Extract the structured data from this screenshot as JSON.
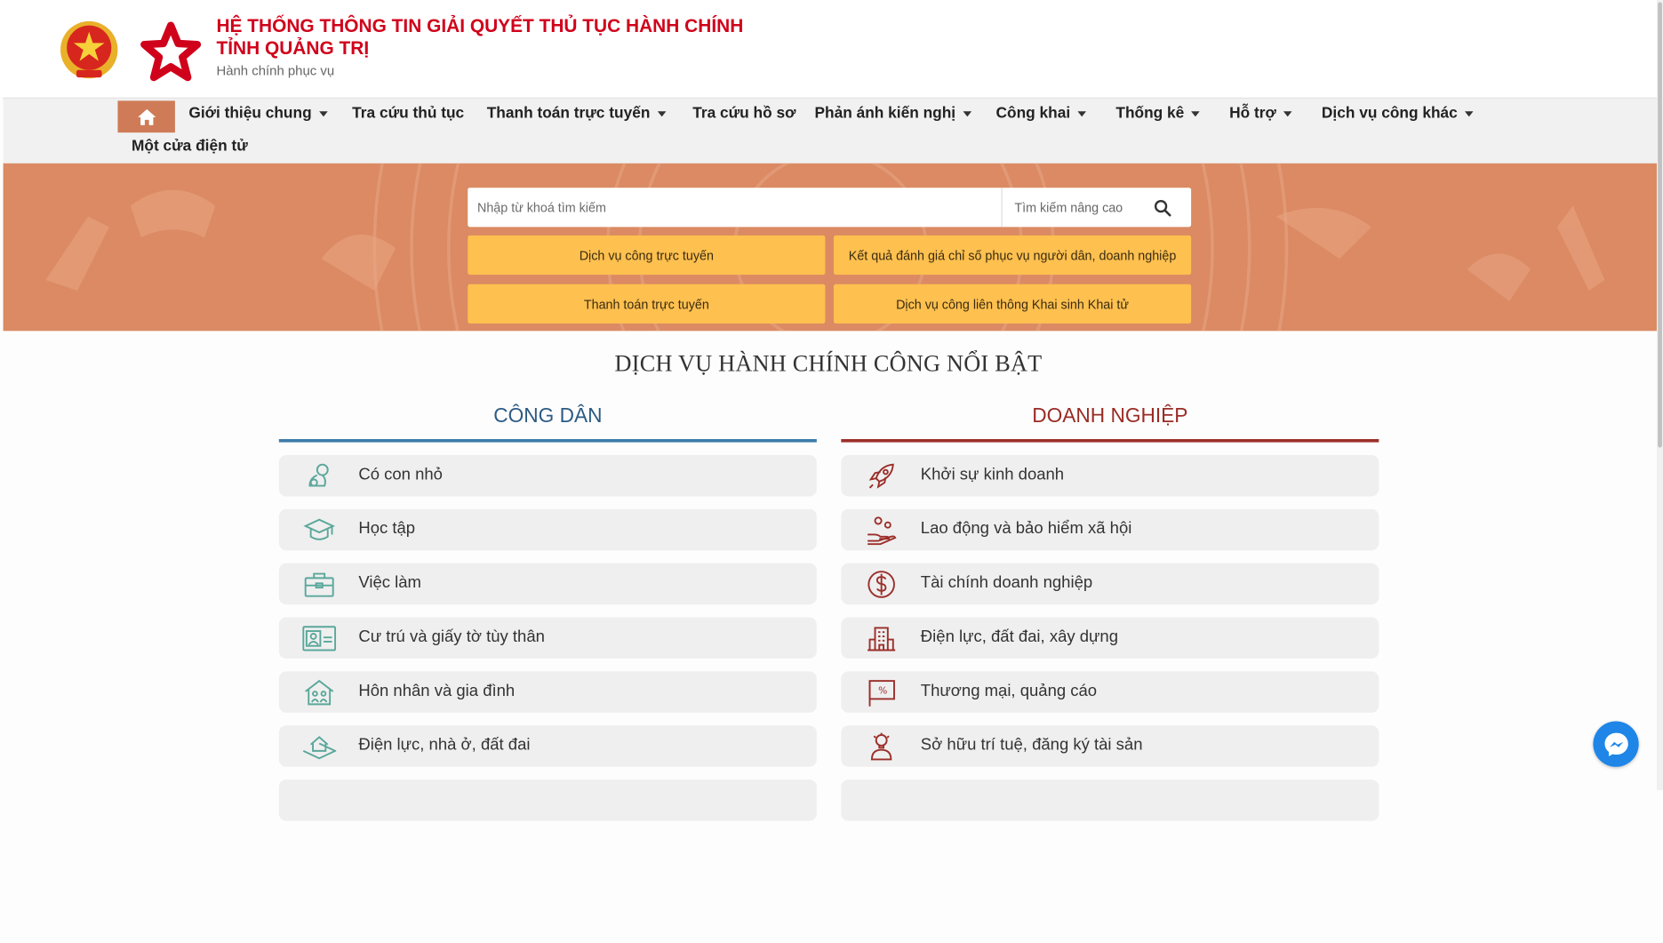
{
  "header": {
    "title_line1": "HỆ THỐNG THÔNG TIN GIẢI QUYẾT THỦ TỤC HÀNH CHÍNH",
    "title_line2": "TỈNH QUẢNG TRỊ",
    "subtitle": "Hành chính phục vụ"
  },
  "nav": {
    "items": [
      {
        "label": "Giới thiệu chung",
        "dropdown": true
      },
      {
        "label": "Tra cứu thủ tục",
        "dropdown": false
      },
      {
        "label": "Thanh toán trực tuyến",
        "dropdown": true
      },
      {
        "label": "Tra cứu hồ sơ",
        "dropdown": false
      },
      {
        "label": "Phản ánh kiến nghị",
        "dropdown": true
      },
      {
        "label": "Công khai",
        "dropdown": true
      },
      {
        "label": "Thống kê",
        "dropdown": true
      },
      {
        "label": "Hỗ trợ",
        "dropdown": true
      },
      {
        "label": "Dịch vụ công khác",
        "dropdown": true
      },
      {
        "label": "Một cửa điện tử",
        "dropdown": false
      }
    ]
  },
  "search": {
    "placeholder": "Nhập từ khoá tìm kiếm",
    "advanced_label": "Tìm kiếm nâng cao"
  },
  "quick_links": [
    "Dịch vụ công trực tuyến",
    "Kết quả đánh giá chỉ số phục vụ người dân, doanh nghiệp",
    "Thanh toán trực tuyến",
    "Dịch vụ công liên thông Khai sinh Khai tử"
  ],
  "featured": {
    "title": "DỊCH VỤ HÀNH CHÍNH CÔNG NỔI BẬT",
    "citizen": {
      "heading": "CÔNG DÂN",
      "items": [
        {
          "label": "Có con nhỏ",
          "icon": "baby-icon"
        },
        {
          "label": "Học tập",
          "icon": "graduation-cap-icon"
        },
        {
          "label": "Việc làm",
          "icon": "briefcase-icon"
        },
        {
          "label": "Cư trú và giấy tờ tùy thân",
          "icon": "id-card-icon"
        },
        {
          "label": "Hôn nhân và gia đình",
          "icon": "family-house-icon"
        },
        {
          "label": "Điện lực, nhà ở, đất đai",
          "icon": "house-land-icon"
        }
      ]
    },
    "business": {
      "heading": "DOANH NGHIỆP",
      "items": [
        {
          "label": "Khởi sự kinh doanh",
          "icon": "rocket-icon"
        },
        {
          "label": "Lao động và bảo hiểm xã hội",
          "icon": "hand-people-icon"
        },
        {
          "label": "Tài chính doanh nghiệp",
          "icon": "dollar-icon"
        },
        {
          "label": "Điện lực, đất đai, xây dựng",
          "icon": "building-icon"
        },
        {
          "label": "Thương mại, quảng cáo",
          "icon": "percent-board-icon"
        },
        {
          "label": "Sở hữu trí tuệ, đăng ký tài sản",
          "icon": "lightbulb-person-icon"
        }
      ]
    }
  },
  "colors": {
    "brand_red": "#d0021b",
    "hero_bg": "#db8a63",
    "quick_btn": "#fec04f",
    "citizen_accent": "#3b7ba8",
    "business_accent": "#9b2f2a",
    "citizen_icon": "#5aa79b"
  }
}
